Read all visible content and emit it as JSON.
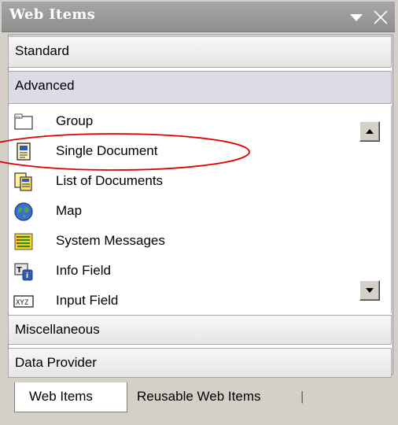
{
  "window": {
    "title": "Web Items"
  },
  "categories": {
    "standard": "Standard",
    "advanced": "Advanced",
    "miscellaneous": "Miscellaneous",
    "data_provider": "Data Provider"
  },
  "items": [
    {
      "label": "Group",
      "icon": "group-icon"
    },
    {
      "label": "Single Document",
      "icon": "single-document-icon"
    },
    {
      "label": "List of Documents",
      "icon": "list-of-documents-icon"
    },
    {
      "label": "Map",
      "icon": "map-icon"
    },
    {
      "label": "System Messages",
      "icon": "system-messages-icon"
    },
    {
      "label": "Info Field",
      "icon": "info-field-icon"
    },
    {
      "label": "Input Field",
      "icon": "input-field-icon"
    }
  ],
  "tabs": {
    "web_items": "Web Items",
    "reusable_web_items": "Reusable Web Items"
  },
  "highlight": {
    "target": "Single Document",
    "color": "#e00000"
  }
}
